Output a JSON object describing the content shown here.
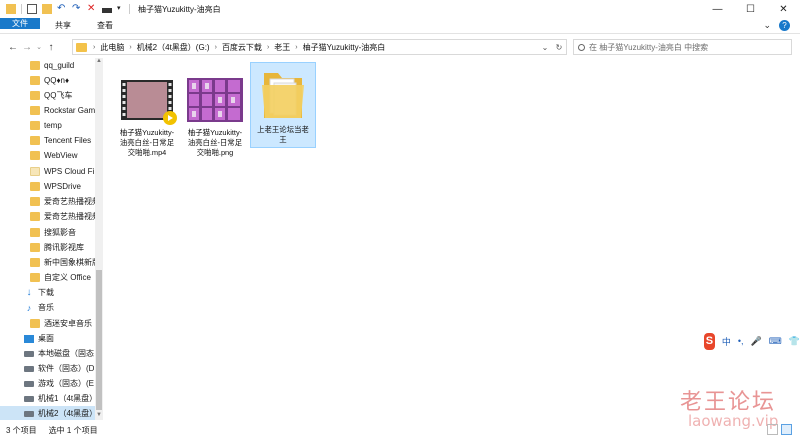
{
  "window": {
    "title": "柚子猫Yuzukitty-油亮白",
    "controls": {
      "minimize": "—",
      "maximize": "☐",
      "close": "✕"
    }
  },
  "ribbon": {
    "tabs": [
      "文件",
      "主页",
      "共享",
      "查看"
    ],
    "expand": "⌄",
    "help": "?"
  },
  "nav": {
    "back": "←",
    "forward": "→",
    "recent": "⌄",
    "up": "↑",
    "breadcrumb": [
      "此电脑",
      "机械2（4t黑盘）(G:)",
      "百度云下载",
      "老王",
      "柚子猫Yuzukitty-油亮白"
    ],
    "dropdown": "⌄",
    "refresh": "↻",
    "search_placeholder": "在 柚子猫Yuzukitty-油亮白 中搜索"
  },
  "sidebar": {
    "items": [
      {
        "label": "qq_guild",
        "icon": "folder-icon"
      },
      {
        "label": "QQ♦n♦",
        "icon": "folder-icon"
      },
      {
        "label": "QQ飞车",
        "icon": "folder-icon"
      },
      {
        "label": "Rockstar Gam",
        "icon": "folder-icon"
      },
      {
        "label": "temp",
        "icon": "folder-icon"
      },
      {
        "label": "Tencent Files",
        "icon": "folder-icon"
      },
      {
        "label": "WebView",
        "icon": "folder-icon"
      },
      {
        "label": "WPS Cloud Fi",
        "icon": "folder-light-icon"
      },
      {
        "label": "WPSDrive",
        "icon": "folder-icon"
      },
      {
        "label": "爱奇艺热播视频",
        "icon": "folder-icon"
      },
      {
        "label": "爱奇艺热播视频",
        "icon": "folder-icon"
      },
      {
        "label": "搜狐影音",
        "icon": "folder-icon"
      },
      {
        "label": "腾讯影视库",
        "icon": "folder-icon"
      },
      {
        "label": "新中国象棋新版",
        "icon": "folder-icon"
      },
      {
        "label": "自定义 Office",
        "icon": "folder-icon"
      },
      {
        "label": "下载",
        "icon": "download-icon"
      },
      {
        "label": "音乐",
        "icon": "music-icon"
      },
      {
        "label": "酒迷安卓音乐",
        "icon": "folder-icon"
      },
      {
        "label": "桌面",
        "icon": "desktop-icon"
      },
      {
        "label": "本地磁盘（固态",
        "icon": "drive-icon"
      },
      {
        "label": "软件（固态）(D",
        "icon": "drive-icon"
      },
      {
        "label": "游戏（固态）(E",
        "icon": "drive-icon"
      },
      {
        "label": "机械1（4t黑盘）",
        "icon": "drive-icon"
      },
      {
        "label": "机械2（4t黑盘）",
        "icon": "drive-icon"
      }
    ]
  },
  "files": [
    {
      "name": "柚子猫Yuzukitty-油亮白丝-日常足交啪啪.mp4",
      "lines": [
        "柚子猫Yuzukitty-",
        "油亮白丝-日常足",
        "交啪啪.mp4"
      ],
      "type": "video"
    },
    {
      "name": "柚子猫Yuzukitty-油亮白丝-日常足交啪啪.png",
      "lines": [
        "柚子猫Yuzukitty-",
        "油亮白丝-日常足",
        "交啪啪.png"
      ],
      "type": "image"
    },
    {
      "name": "上老王论坛当老王",
      "lines": [
        "上老王论坛当老",
        "王"
      ],
      "type": "folder"
    }
  ],
  "status": {
    "count": "3 个项目",
    "selected": "选中 1 个项目"
  },
  "ime": {
    "logo": "S",
    "mode": "中",
    "punct": "•,",
    "mic": "🎤",
    "keyboard": "⌨",
    "skin": "👕"
  },
  "watermark": {
    "cn": "老王论坛",
    "en": "laowang.vip"
  },
  "colors": {
    "accent": "#1979ca",
    "selection": "#cce8ff",
    "folder": "#f1c152"
  }
}
